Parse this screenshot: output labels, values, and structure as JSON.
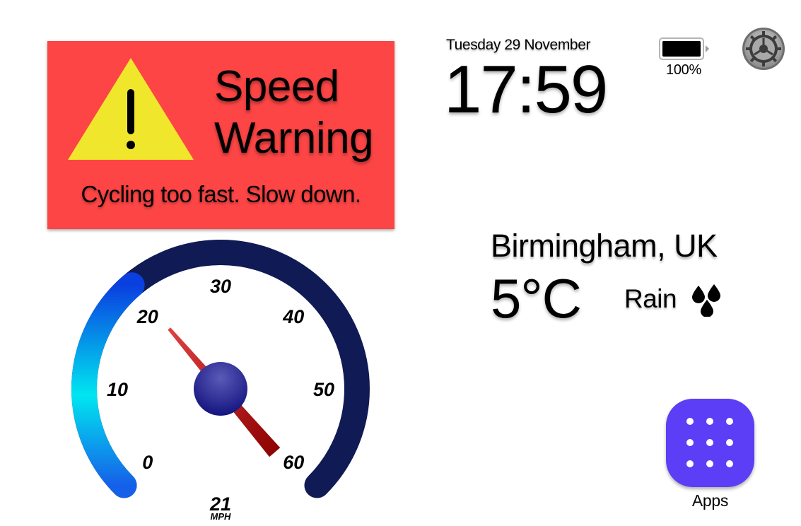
{
  "warning": {
    "title": "Speed\nWarning",
    "message": "Cycling too fast. Slow down.",
    "background_color": "#fd4545",
    "triangle_color": "#f0e72c",
    "icon": "warning-triangle-icon"
  },
  "clock": {
    "date": "Tuesday 29 November",
    "time": "17:59"
  },
  "battery": {
    "level": 1.0,
    "label": "100%",
    "icon": "battery-icon"
  },
  "settings": {
    "icon": "gear-icon"
  },
  "weather": {
    "location": "Birmingham, UK",
    "temperature": "5°C",
    "condition": "Rain",
    "icon": "rain-drops-icon"
  },
  "speedometer": {
    "ticks": [
      "0",
      "10",
      "20",
      "30",
      "40",
      "50",
      "60"
    ],
    "min": 0,
    "max": 60,
    "speed": "21",
    "speed_value": 21,
    "unit": "MPH",
    "track_color": "#101a55",
    "gradient_colors": [
      "#0a3fe0",
      "#00e6f0",
      "#1560e8"
    ],
    "needle_color": "#a01010",
    "hub_color": "#2a2a8a"
  },
  "apps": {
    "label": "Apps",
    "color": "#5c3ef6",
    "icon": "app-grid-icon"
  }
}
